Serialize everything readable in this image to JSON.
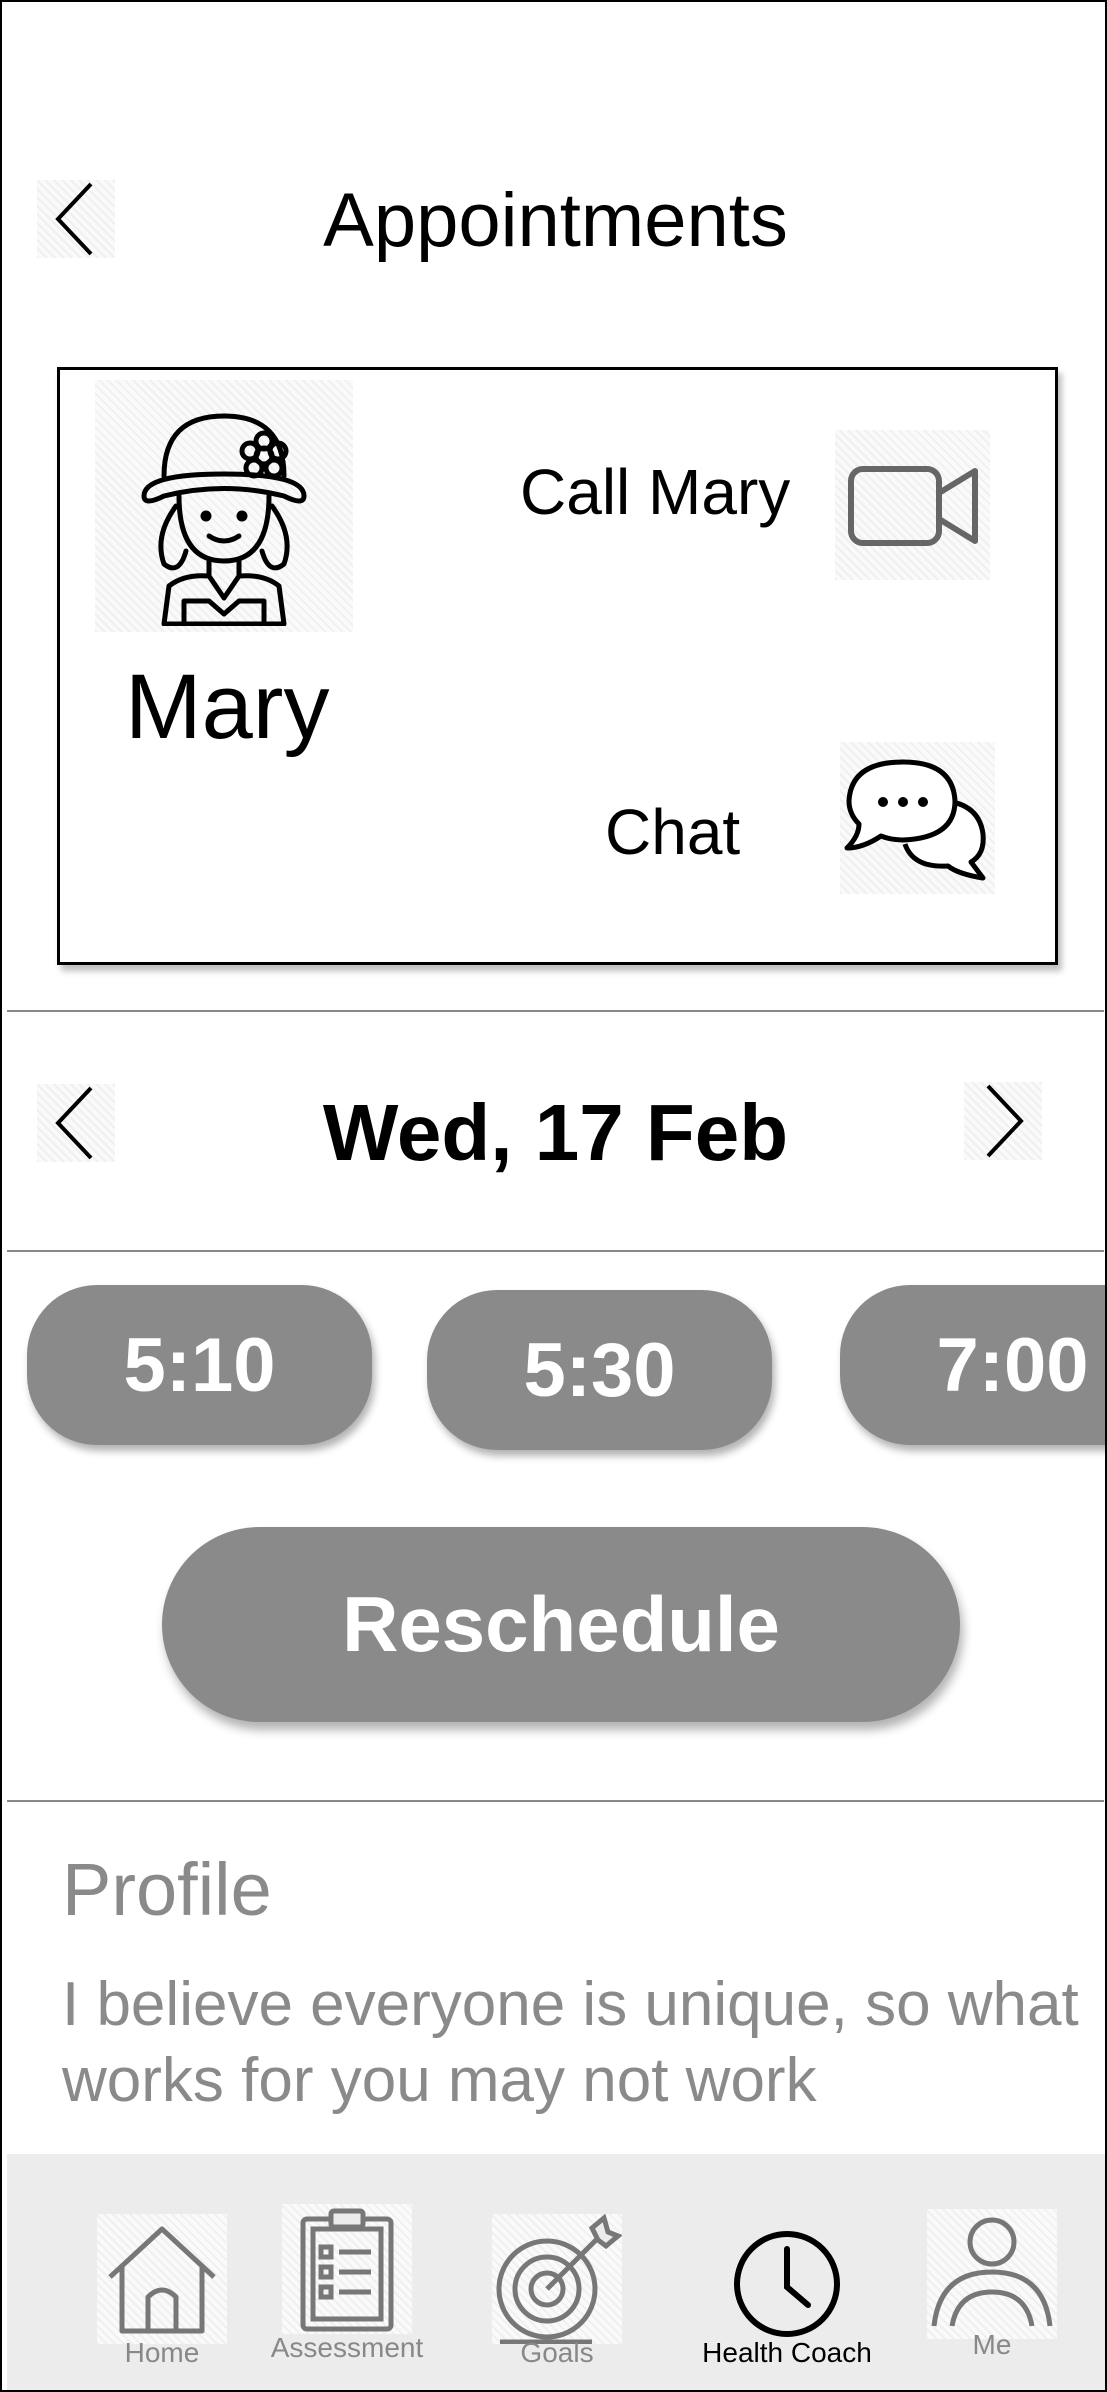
{
  "header": {
    "title": "Appointments"
  },
  "coach": {
    "name": "Mary",
    "call_label": "Call Mary",
    "chat_label": "Chat"
  },
  "date_picker": {
    "date": "Wed, 17 Feb"
  },
  "time_slots": [
    "5:10",
    "5:30",
    "7:00"
  ],
  "reschedule_label": "Reschedule",
  "profile": {
    "heading": "Profile",
    "text": "I believe everyone is unique, so what works for you may not work"
  },
  "nav": {
    "items": [
      {
        "label": "Home",
        "icon": "home-icon"
      },
      {
        "label": "Assessment",
        "icon": "clipboard-icon"
      },
      {
        "label": "Goals",
        "icon": "target-icon"
      },
      {
        "label": "Health Coach",
        "icon": "clock-icon"
      },
      {
        "label": "Me",
        "icon": "user-icon"
      }
    ],
    "active": "Health Coach"
  },
  "colors": {
    "pill": "#8a8a8a",
    "nav_bg": "#ececec",
    "muted_text": "#8a8a8a"
  }
}
